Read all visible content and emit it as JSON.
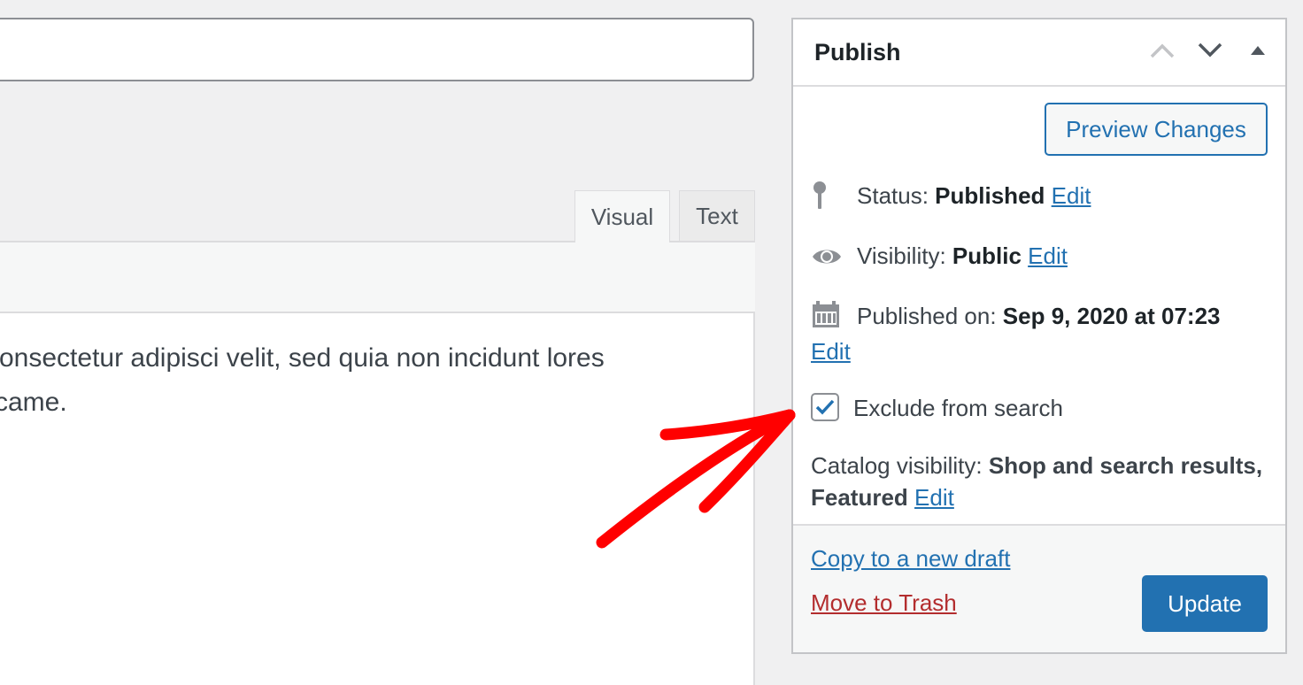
{
  "colors": {
    "accent": "#2271b1",
    "trash": "#b32d2e",
    "arrow": "#ff0000",
    "background": "#f0f0f1"
  },
  "editor": {
    "tabs": [
      {
        "label": "Visual",
        "active": true
      },
      {
        "label": "Text",
        "active": false
      }
    ],
    "content_lines": [
      "consectetur adipisci velit, sed quia non incidunt lores",
      "rcame."
    ]
  },
  "publish": {
    "title": "Publish",
    "controls": [
      "chevron-up-icon",
      "chevron-down-icon",
      "triangle-up-icon"
    ],
    "preview_button": "Preview Changes",
    "status": {
      "label": "Status:",
      "value": "Published",
      "edit": "Edit",
      "icon": "pin-icon"
    },
    "visibility": {
      "label": "Visibility:",
      "value": "Public",
      "edit": "Edit",
      "icon": "eye-icon"
    },
    "published_on": {
      "label": "Published on:",
      "value": "Sep 9, 2020 at 07:23",
      "edit": "Edit",
      "icon": "calendar-icon"
    },
    "exclude_search": {
      "label": "Exclude from search",
      "checked": true
    },
    "catalog": {
      "label": "Catalog visibility:",
      "value": "Shop and search results, Featured",
      "edit": "Edit"
    },
    "footer": {
      "copy_link": "Copy to a new draft",
      "trash_link": "Move to Trash",
      "update_button": "Update"
    }
  }
}
